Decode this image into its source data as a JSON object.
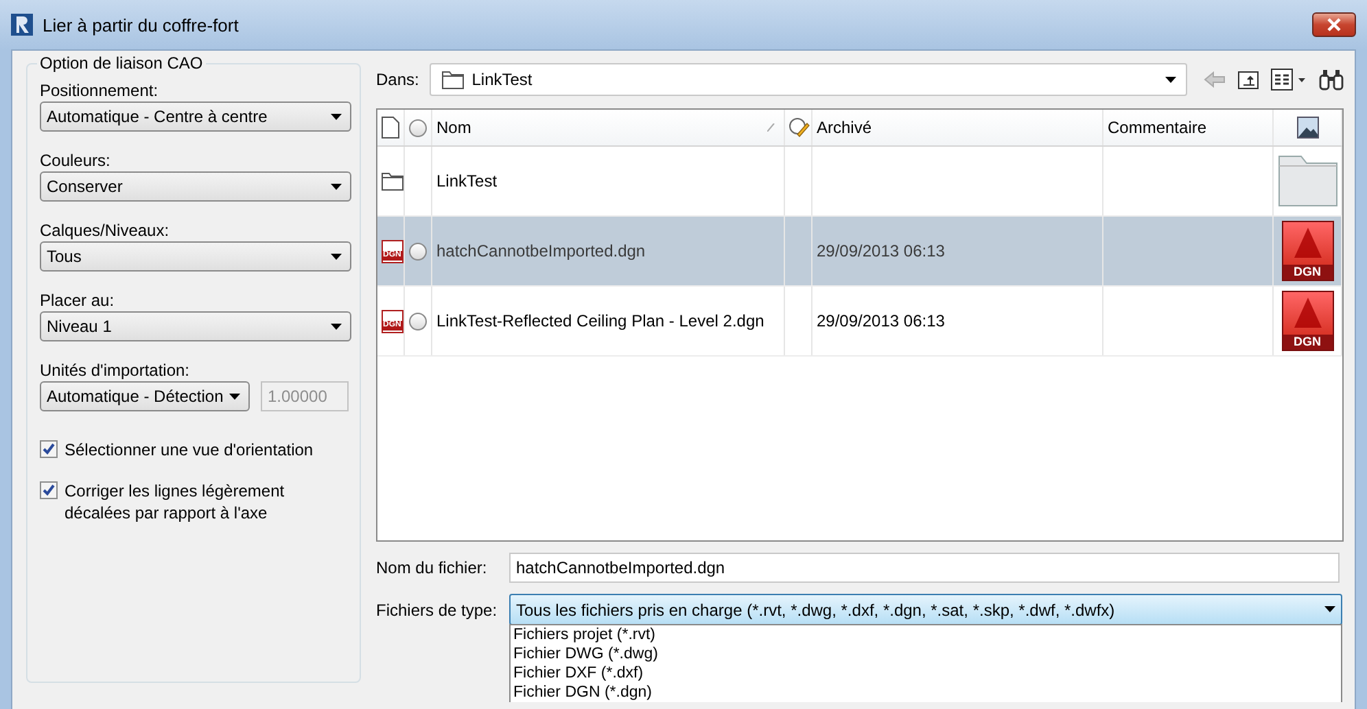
{
  "window": {
    "title": "Lier à partir du coffre-fort"
  },
  "cad_options": {
    "title": "Option de liaison CAO",
    "dropdowns": [
      {
        "label": "Positionnement:",
        "value": "Automatique - Centre à centre"
      },
      {
        "label": "Couleurs:",
        "value": "Conserver"
      },
      {
        "label": "Calques/Niveaux:",
        "value": "Tous"
      },
      {
        "label": "Placer au:",
        "value": "Niveau 1"
      }
    ],
    "import_units": {
      "label": "Unités d'importation:",
      "value": "Automatique - Détection",
      "scale": "1.00000",
      "scale_disabled": true
    },
    "checkboxes": [
      {
        "label": "Sélectionner une vue d'orientation",
        "checked": true
      },
      {
        "label": "Corriger les lignes légèrement décalées par rapport à l'axe",
        "checked": true
      }
    ]
  },
  "location": {
    "label": "Dans:",
    "value": "LinkTest"
  },
  "file_list": {
    "columns": [
      {
        "label": "Nom"
      },
      {
        "label": "Archivé"
      },
      {
        "label": "Commentaire"
      }
    ],
    "rows": [
      {
        "kind": "folder",
        "name": "LinkTest",
        "selected": false
      },
      {
        "kind": "dgn",
        "icon_label": "DGN",
        "name": "hatchCannotbeImported.dgn",
        "archived": "29/09/2013 06:13",
        "thumbnail_label": "DGN",
        "selected": true
      },
      {
        "kind": "dgn",
        "icon_label": "DGN",
        "name": "LinkTest-Reflected Ceiling Plan - Level 2.dgn",
        "archived": "29/09/2013 06:13",
        "thumbnail_label": "DGN",
        "selected": false
      }
    ]
  },
  "file_name": {
    "label": "Nom du fichier:",
    "value": "hatchCannotbeImported.dgn"
  },
  "file_type": {
    "label": "Fichiers de type:",
    "value": "Tous les fichiers pris en charge (*.rvt, *.dwg, *.dxf, *.dgn, *.sat, *.skp, *.dwf, *.dwfx)",
    "expanded": true,
    "options": [
      "Fichiers projet (*.rvt)",
      "Fichier DWG (*.dwg)",
      "Fichier DXF (*.dxf)",
      "Fichier DGN (*.dgn)"
    ]
  }
}
